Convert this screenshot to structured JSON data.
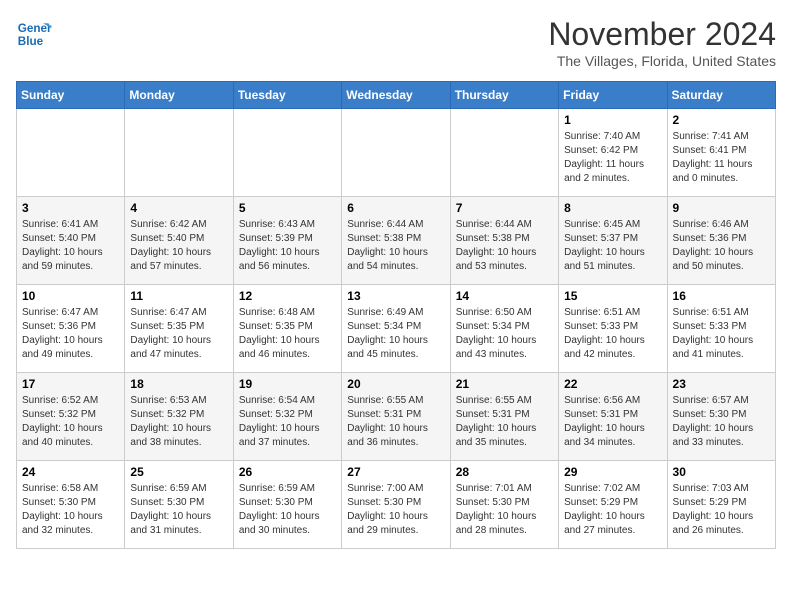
{
  "header": {
    "logo_line1": "General",
    "logo_line2": "Blue",
    "month": "November 2024",
    "location": "The Villages, Florida, United States"
  },
  "weekdays": [
    "Sunday",
    "Monday",
    "Tuesday",
    "Wednesday",
    "Thursday",
    "Friday",
    "Saturday"
  ],
  "weeks": [
    [
      {
        "day": "",
        "info": ""
      },
      {
        "day": "",
        "info": ""
      },
      {
        "day": "",
        "info": ""
      },
      {
        "day": "",
        "info": ""
      },
      {
        "day": "",
        "info": ""
      },
      {
        "day": "1",
        "info": "Sunrise: 7:40 AM\nSunset: 6:42 PM\nDaylight: 11 hours\nand 2 minutes."
      },
      {
        "day": "2",
        "info": "Sunrise: 7:41 AM\nSunset: 6:41 PM\nDaylight: 11 hours\nand 0 minutes."
      }
    ],
    [
      {
        "day": "3",
        "info": "Sunrise: 6:41 AM\nSunset: 5:40 PM\nDaylight: 10 hours\nand 59 minutes."
      },
      {
        "day": "4",
        "info": "Sunrise: 6:42 AM\nSunset: 5:40 PM\nDaylight: 10 hours\nand 57 minutes."
      },
      {
        "day": "5",
        "info": "Sunrise: 6:43 AM\nSunset: 5:39 PM\nDaylight: 10 hours\nand 56 minutes."
      },
      {
        "day": "6",
        "info": "Sunrise: 6:44 AM\nSunset: 5:38 PM\nDaylight: 10 hours\nand 54 minutes."
      },
      {
        "day": "7",
        "info": "Sunrise: 6:44 AM\nSunset: 5:38 PM\nDaylight: 10 hours\nand 53 minutes."
      },
      {
        "day": "8",
        "info": "Sunrise: 6:45 AM\nSunset: 5:37 PM\nDaylight: 10 hours\nand 51 minutes."
      },
      {
        "day": "9",
        "info": "Sunrise: 6:46 AM\nSunset: 5:36 PM\nDaylight: 10 hours\nand 50 minutes."
      }
    ],
    [
      {
        "day": "10",
        "info": "Sunrise: 6:47 AM\nSunset: 5:36 PM\nDaylight: 10 hours\nand 49 minutes."
      },
      {
        "day": "11",
        "info": "Sunrise: 6:47 AM\nSunset: 5:35 PM\nDaylight: 10 hours\nand 47 minutes."
      },
      {
        "day": "12",
        "info": "Sunrise: 6:48 AM\nSunset: 5:35 PM\nDaylight: 10 hours\nand 46 minutes."
      },
      {
        "day": "13",
        "info": "Sunrise: 6:49 AM\nSunset: 5:34 PM\nDaylight: 10 hours\nand 45 minutes."
      },
      {
        "day": "14",
        "info": "Sunrise: 6:50 AM\nSunset: 5:34 PM\nDaylight: 10 hours\nand 43 minutes."
      },
      {
        "day": "15",
        "info": "Sunrise: 6:51 AM\nSunset: 5:33 PM\nDaylight: 10 hours\nand 42 minutes."
      },
      {
        "day": "16",
        "info": "Sunrise: 6:51 AM\nSunset: 5:33 PM\nDaylight: 10 hours\nand 41 minutes."
      }
    ],
    [
      {
        "day": "17",
        "info": "Sunrise: 6:52 AM\nSunset: 5:32 PM\nDaylight: 10 hours\nand 40 minutes."
      },
      {
        "day": "18",
        "info": "Sunrise: 6:53 AM\nSunset: 5:32 PM\nDaylight: 10 hours\nand 38 minutes."
      },
      {
        "day": "19",
        "info": "Sunrise: 6:54 AM\nSunset: 5:32 PM\nDaylight: 10 hours\nand 37 minutes."
      },
      {
        "day": "20",
        "info": "Sunrise: 6:55 AM\nSunset: 5:31 PM\nDaylight: 10 hours\nand 36 minutes."
      },
      {
        "day": "21",
        "info": "Sunrise: 6:55 AM\nSunset: 5:31 PM\nDaylight: 10 hours\nand 35 minutes."
      },
      {
        "day": "22",
        "info": "Sunrise: 6:56 AM\nSunset: 5:31 PM\nDaylight: 10 hours\nand 34 minutes."
      },
      {
        "day": "23",
        "info": "Sunrise: 6:57 AM\nSunset: 5:30 PM\nDaylight: 10 hours\nand 33 minutes."
      }
    ],
    [
      {
        "day": "24",
        "info": "Sunrise: 6:58 AM\nSunset: 5:30 PM\nDaylight: 10 hours\nand 32 minutes."
      },
      {
        "day": "25",
        "info": "Sunrise: 6:59 AM\nSunset: 5:30 PM\nDaylight: 10 hours\nand 31 minutes."
      },
      {
        "day": "26",
        "info": "Sunrise: 6:59 AM\nSunset: 5:30 PM\nDaylight: 10 hours\nand 30 minutes."
      },
      {
        "day": "27",
        "info": "Sunrise: 7:00 AM\nSunset: 5:30 PM\nDaylight: 10 hours\nand 29 minutes."
      },
      {
        "day": "28",
        "info": "Sunrise: 7:01 AM\nSunset: 5:30 PM\nDaylight: 10 hours\nand 28 minutes."
      },
      {
        "day": "29",
        "info": "Sunrise: 7:02 AM\nSunset: 5:29 PM\nDaylight: 10 hours\nand 27 minutes."
      },
      {
        "day": "30",
        "info": "Sunrise: 7:03 AM\nSunset: 5:29 PM\nDaylight: 10 hours\nand 26 minutes."
      }
    ]
  ]
}
